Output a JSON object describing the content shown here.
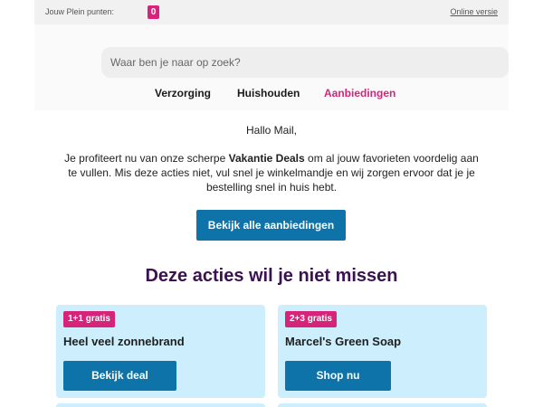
{
  "topbar": {
    "points_label": "Jouw Plein punten:",
    "points_value": "0",
    "online_link": "Online versie"
  },
  "search": {
    "placeholder": "Waar ben je naar op zoek?"
  },
  "nav": {
    "items": [
      {
        "label": "Verzorging"
      },
      {
        "label": "Huishouden"
      },
      {
        "label": "Aanbiedingen"
      }
    ]
  },
  "content": {
    "greeting": "Hallo Mail,",
    "intro_before": "Je profiteert nu van onze scherpe ",
    "intro_bold": "Vakantie Deals",
    "intro_after": " om al jouw favorieten voordelig aan te vullen. Mis deze acties niet, vul snel je winkelmandje en wij zorgen ervoor dat je je bestelling snel in huis hebt.",
    "cta_label": "Bekijk alle aanbiedingen",
    "section_title": "Deze acties wil je niet missen"
  },
  "deals": [
    {
      "badge": "1+1 gratis",
      "title": "Heel veel zonnebrand",
      "button": "Bekijk deal"
    },
    {
      "badge": "2+3 gratis",
      "title": "Marcel's Green Soap",
      "button": "Shop nu"
    }
  ],
  "colors": {
    "accent_pink": "#d6247a",
    "button_blue": "#0d73a8",
    "title_purple": "#3c1151",
    "card_bg": "#cdeefc"
  }
}
